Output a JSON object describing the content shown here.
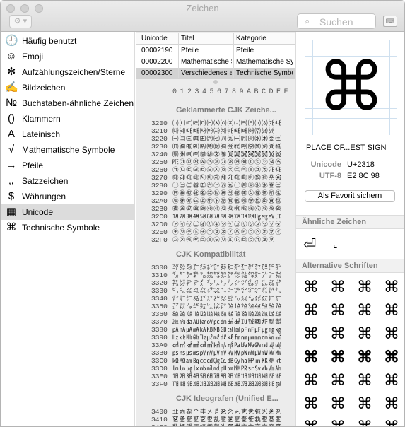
{
  "window": {
    "title": "Zeichen"
  },
  "toolbar": {
    "gear_icon": "gear-icon",
    "search_placeholder": "Suchen",
    "search_icon": "magnifier-icon",
    "keyboard_icon": "keyboard-viewer-icon"
  },
  "sidebar": {
    "items": [
      {
        "icon": "🕘",
        "label": "Häufig benutzt"
      },
      {
        "icon": "☺",
        "label": "Emoji"
      },
      {
        "icon": "✻",
        "label": "Aufzählungszeichen/Sterne"
      },
      {
        "icon": "✍",
        "label": "Bildzeichen"
      },
      {
        "icon": "№",
        "label": "Buchstaben-ähnliche Zeichen"
      },
      {
        "icon": "()",
        "label": "Klammern"
      },
      {
        "icon": "A",
        "label": "Lateinisch"
      },
      {
        "icon": "√",
        "label": "Mathematische Symbole"
      },
      {
        "icon": "→",
        "label": "Pfeile"
      },
      {
        "icon": "‚,",
        "label": "Satzzeichen"
      },
      {
        "icon": "$",
        "label": "Währungen"
      },
      {
        "icon": "▦",
        "label": "Unicode"
      },
      {
        "icon": "⌘",
        "label": "Technische Symbole"
      }
    ],
    "selected_index": 11
  },
  "table": {
    "headers": [
      "Unicode",
      "Titel",
      "Kategorie"
    ],
    "rows": [
      {
        "unicode": "00002190",
        "titel": "Pfeile",
        "kategorie": "Pfeile"
      },
      {
        "unicode": "00002200",
        "titel": "Mathematische S",
        "kategorie": "Mathematische Sy"
      },
      {
        "unicode": "00002300",
        "titel": "Verschiedenes a",
        "kategorie": "Technische Symbo"
      }
    ],
    "selected_row": 2
  },
  "hex_header": [
    "0",
    "1",
    "2",
    "3",
    "4",
    "5",
    "6",
    "7",
    "8",
    "9",
    "A",
    "B",
    "C",
    "D",
    "E",
    "F"
  ],
  "sections": [
    {
      "title": "Geklammerte CJK Zeiche...",
      "rows": [
        {
          "cp": "3200",
          "g": "㈀㈁㈂㈃㈄㈅㈆㈇㈈㈉㈊㈋㈌㈍㈎㈏"
        },
        {
          "cp": "3210",
          "g": "㈐㈑㈒㈓㈔㈕㈖㈗㈘㈙㈚㈛㈜㈝㈞"
        },
        {
          "cp": "3220",
          "g": "㈠㈡㈢㈣㈤㈥㈦㈧㈨㈩㈪㈫㈬㈭㈮㈯"
        },
        {
          "cp": "3230",
          "g": "㈰㈱㈲㈳㈴㈵㈶㈷㈸㈹㈺㈻㈼㈽㈾㈿"
        },
        {
          "cp": "3240",
          "g": "㉀㉁㉂㉃㉄㉅㉆㉇㉈㉉㉊㉋㉌㉍㉎㉏"
        },
        {
          "cp": "3250",
          "g": "㉐㉑㉒㉓㉔㉕㉖㉗㉘㉙㉚㉛㉜㉝㉞㉟"
        },
        {
          "cp": "3260",
          "g": "㉠㉡㉢㉣㉤㉥㉦㉧㉨㉩㉪㉫㉬㉭㉮㉯"
        },
        {
          "cp": "3270",
          "g": "㉰㉱㉲㉳㉴㉵㉶㉷㉸㉹㉺㉻㉼㉽㉾㉿"
        },
        {
          "cp": "3280",
          "g": "㊀㊁㊂㊃㊄㊅㊆㊇㊈㊉㊊㊋㊌㊍㊎㊏"
        },
        {
          "cp": "3290",
          "g": "㊐㊑㊒㊓㊔㊕㊖㊗㊘㊙㊚㊛㊜㊝㊞㊟"
        },
        {
          "cp": "32A0",
          "g": "㊠㊡㊢㊣㊤㊥㊦㊧㊨㊩㊪㊫㊬㊭㊮㊯"
        },
        {
          "cp": "32B0",
          "g": "㊰㊱㊲㊳㊴㊵㊶㊷㊸㊹㊺㊻㊼㊽㊾㊿"
        },
        {
          "cp": "32C0",
          "g": "㋀㋁㋂㋃㋄㋅㋆㋇㋈㋉㋊㋋㋌㋍㋎㋏"
        },
        {
          "cp": "32D0",
          "g": "㋐㋑㋒㋓㋔㋕㋖㋗㋘㋙㋚㋛㋜㋝㋞㋟"
        },
        {
          "cp": "32E0",
          "g": "㋠㋡㋢㋣㋤㋥㋦㋧㋨㋩㋪㋫㋬㋭㋮㋯"
        },
        {
          "cp": "32F0",
          "g": "㋰㋱㋲㋳㋴㋵㋶㋷㋸㋹㋺㋻㋼㋽㋾"
        }
      ]
    },
    {
      "title": "CJK Kompatibilität",
      "rows": [
        {
          "cp": "3300",
          "g": "㌀㌁㌂㌃㌄㌅㌆㌇㌈㌉㌊㌋㌌㌍㌎㌏"
        },
        {
          "cp": "3310",
          "g": "㌐㌑㌒㌓㌔㌕㌖㌗㌘㌙㌚㌛㌜㌝㌞㌟"
        },
        {
          "cp": "3320",
          "g": "㌠㌡㌢㌣㌤㌥㌦㌧㌨㌩㌪㌫㌬㌭㌮㌯"
        },
        {
          "cp": "3330",
          "g": "㌰㌱㌲㌳㌴㌵㌶㌷㌸㌹㌺㌻㌼㌽㌾㌿"
        },
        {
          "cp": "3340",
          "g": "㍀㍁㍂㍃㍄㍅㍆㍇㍈㍉㍊㍋㍌㍍㍎㍏"
        },
        {
          "cp": "3350",
          "g": "㍐㍑㍒㍓㍔㍕㍖㍗㍘㍙㍚㍛㍜㍝㍞㍟"
        },
        {
          "cp": "3360",
          "g": "㍠㍡㍢㍣㍤㍥㍦㍧㍨㍩㍪㍫㍬㍭㍮㍯"
        },
        {
          "cp": "3370",
          "g": "㍰㍱㍲㍳㍴㍵㍶㍷㍸㍹㍺㍻㍼㍽㍾㍿"
        },
        {
          "cp": "3380",
          "g": "㎀㎁㎂㎃㎄㎅㎆㎇㎈㎉㎊㎋㎌㎍㎎㎏"
        },
        {
          "cp": "3390",
          "g": "㎐㎑㎒㎓㎔㎕㎖㎗㎘㎙㎚㎛㎜㎝㎞㎟"
        },
        {
          "cp": "33A0",
          "g": "㎠㎡㎢㎣㎤㎥㎦㎧㎨㎩㎪㎫㎬㎭㎮㎯"
        },
        {
          "cp": "33B0",
          "g": "㎰㎱㎲㎳㎴㎵㎶㎷㎸㎹㎺㎻㎼㎽㎾㎿"
        },
        {
          "cp": "33C0",
          "g": "㏀㏁㏂㏃㏄㏅㏆㏇㏈㏉㏊㏋㏌㏍㏎㏏"
        },
        {
          "cp": "33D0",
          "g": "㏐㏑㏒㏓㏔㏕㏖㏗㏘㏙㏚㏛㏜㏝㏞㏟"
        },
        {
          "cp": "33E0",
          "g": "㏠㏡㏢㏣㏤㏥㏦㏧㏨㏩㏪㏫㏬㏭㏮㏯"
        },
        {
          "cp": "33F0",
          "g": "㏰㏱㏲㏳㏴㏵㏶㏷㏸㏹㏺㏻㏼㏽㏾㏿"
        }
      ]
    },
    {
      "title": "CJK Ideografen (Unified E...",
      "rows": [
        {
          "cp": "3400",
          "g": "㐀㐁㐂㐃㐄㐅㐆㐇㐈㐉㐊㐋㐌㐍㐎㐏"
        },
        {
          "cp": "3410",
          "g": "㐐㐑㐒㐓㐔㐕㐖㐗㐘㐙㐚㐛㐜㐝㐞㐟"
        },
        {
          "cp": "3420",
          "g": "㐠㐡㐢㐣㐤㐥㐦㐧㐨㐩㐪㐫㐬㐭㐮㐯"
        }
      ]
    }
  ],
  "detail": {
    "glyph": "⌘",
    "name": "PLACE OF...EST SIGN",
    "unicode_label": "Unicode",
    "unicode_value": "U+2318",
    "utf8_label": "UTF-8",
    "utf8_value": "E2 8C 98",
    "favorite_button": "Als Favorit sichern"
  },
  "similar": {
    "title": "Ähnliche Zeichen",
    "chars": [
      "⏎",
      "⌞"
    ]
  },
  "alternative": {
    "title": "Alternative Schriften",
    "rows": [
      [
        "⌘",
        "⌘",
        "⌘",
        "⌘"
      ],
      [
        "⌘",
        "⌘",
        "⌘",
        "⌘"
      ],
      [
        "⌘",
        "⌘",
        "⌘",
        "⌘"
      ],
      [
        "⌘",
        "⌘",
        "⌘",
        "⌘"
      ],
      [
        "⌘",
        "⌘",
        "⌘",
        "⌘"
      ],
      [
        "⌘",
        "⌘",
        "⌘",
        "⌘"
      ],
      [
        "⌘",
        "⌘",
        "⌘",
        "⌘"
      ]
    ]
  }
}
